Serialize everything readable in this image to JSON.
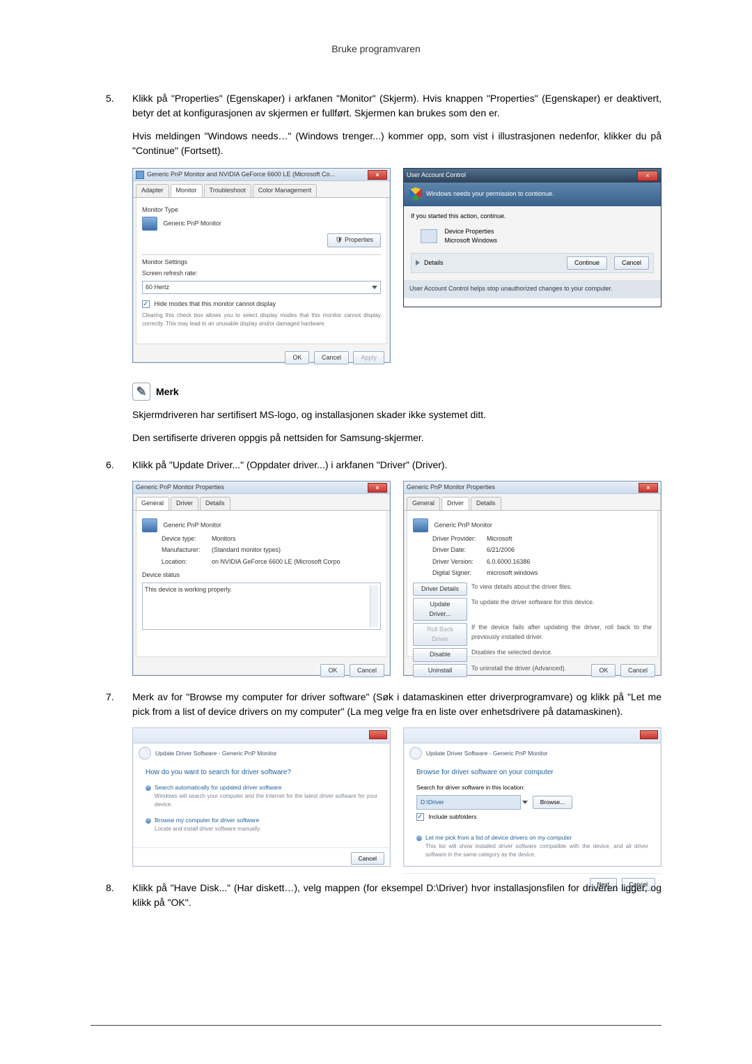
{
  "page_header": "Bruke programvaren",
  "step5": {
    "num": "5.",
    "text": "Klikk på \"Properties\" (Egenskaper) i arkfanen \"Monitor\" (Skjerm). Hvis knappen \"Properties\" (Egenskaper) er deaktivert, betyr det at konfigurasjonen av skjermen er fullført. Skjermen kan brukes som den er.",
    "text2": "Hvis meldingen \"Windows needs…\" (Windows trenger...) kommer opp, som vist i illustrasjonen nedenfor, klikker du på \"Continue\" (Fortsett)."
  },
  "monitor_dlg": {
    "title": "Generic PnP Monitor and NVIDIA GeForce 6600 LE (Microsoft Co...",
    "tabs": [
      "Adapter",
      "Monitor",
      "Troubleshoot",
      "Color Management"
    ],
    "monitor_type_label": "Monitor Type",
    "monitor_name": "Generic PnP Monitor",
    "properties_btn": "Properties",
    "settings_label": "Monitor Settings",
    "refresh_label": "Screen refresh rate:",
    "refresh_value": "60 Hertz",
    "hide_modes_check": "Hide modes that this monitor cannot display",
    "hide_modes_desc": "Clearing this check box allows you to select display modes that this monitor cannot display correctly. This may lead to an unusable display and/or damaged hardware.",
    "ok": "OK",
    "cancel": "Cancel",
    "apply": "Apply"
  },
  "uac": {
    "title": "User Account Control",
    "band": "Windows needs your permission to contionue.",
    "started": "If you started this action, continue.",
    "app_name": "Device Properties",
    "publisher": "Microsoft Windows",
    "details": "Details",
    "continue": "Continue",
    "cancel": "Cancel",
    "footer": "User Account Control helps stop unauthorized changes to your computer."
  },
  "note": {
    "label": "Merk",
    "line1": "Skjermdriveren har sertifisert MS-logo, og installasjonen skader ikke systemet ditt.",
    "line2": "Den sertifiserte driveren oppgis på nettsiden for Samsung-skjermer."
  },
  "step6": {
    "num": "6.",
    "text": "Klikk på \"Update Driver...\" (Oppdater driver...) i arkfanen \"Driver\" (Driver)."
  },
  "prop_general": {
    "title": "Generic PnP Monitor Properties",
    "tabs": [
      "General",
      "Driver",
      "Details"
    ],
    "name": "Generic PnP Monitor",
    "device_type_l": "Device type:",
    "device_type_v": "Monitors",
    "manufacturer_l": "Manufacturer:",
    "manufacturer_v": "(Standard monitor types)",
    "location_l": "Location:",
    "location_v": "on NVIDIA GeForce 6600 LE (Microsoft Corpo",
    "device_status_l": "Device status",
    "device_status_v": "This device is working properly.",
    "ok": "OK",
    "cancel": "Cancel"
  },
  "prop_driver": {
    "title": "Generic PnP Monitor Properties",
    "tabs": [
      "General",
      "Driver",
      "Details"
    ],
    "name": "Generic PnP Monitor",
    "provider_l": "Driver Provider:",
    "provider_v": "Microsoft",
    "date_l": "Driver Date:",
    "date_v": "6/21/2006",
    "version_l": "Driver Version:",
    "version_v": "6.0.6000.16386",
    "signer_l": "Digital Signer:",
    "signer_v": "microsoft windows",
    "btn_details": "Driver Details",
    "btn_details_d": "To view details about the driver files.",
    "btn_update": "Update Driver...",
    "btn_update_d": "To update the driver software for this device.",
    "btn_rollback": "Roll Back Driver",
    "btn_rollback_d": "If the device fails after updating the driver, roll back to the previously installed driver.",
    "btn_disable": "Disable",
    "btn_disable_d": "Disables the selected device.",
    "btn_uninstall": "Uninstall",
    "btn_uninstall_d": "To uninstall the driver (Advanced).",
    "ok": "OK",
    "cancel": "Cancel"
  },
  "step7": {
    "num": "7.",
    "text": "Merk av for \"Browse my computer for driver software\" (Søk i datamaskinen etter driverprogramvare) og klikk på \"Let me pick from a list of device drivers on my computer\" (La meg velge fra en liste over enhetsdrivere på datamaskinen)."
  },
  "wiz1": {
    "crumb": "Update Driver Software - Generic PnP Monitor",
    "heading": "How do you want to search for driver software?",
    "opt1_t": "Search automatically for updated driver software",
    "opt1_s": "Windows will search your computer and the Internet for the latest driver software for your device.",
    "opt2_t": "Browse my computer for driver software",
    "opt2_s": "Locate and install driver software manually.",
    "cancel": "Cancel"
  },
  "wiz2": {
    "crumb": "Update Driver Software - Generic PnP Monitor",
    "heading": "Browse for driver software on your computer",
    "search_label": "Search for driver software in this location:",
    "path": "D:\\Driver",
    "browse": "Browse...",
    "include_sub": "Include subfolders",
    "opt_t": "Let me pick from a list of device drivers on my computer",
    "opt_s": "This list will show installed driver software compatible with the device, and all driver software in the same category as the device.",
    "next": "Next",
    "cancel": "Cancel"
  },
  "step8": {
    "num": "8.",
    "text": "Klikk på \"Have Disk...\" (Har diskett…), velg mappen (for eksempel D:\\Driver) hvor installasjonsfilen for driveren ligger, og klikk på \"OK\"."
  }
}
